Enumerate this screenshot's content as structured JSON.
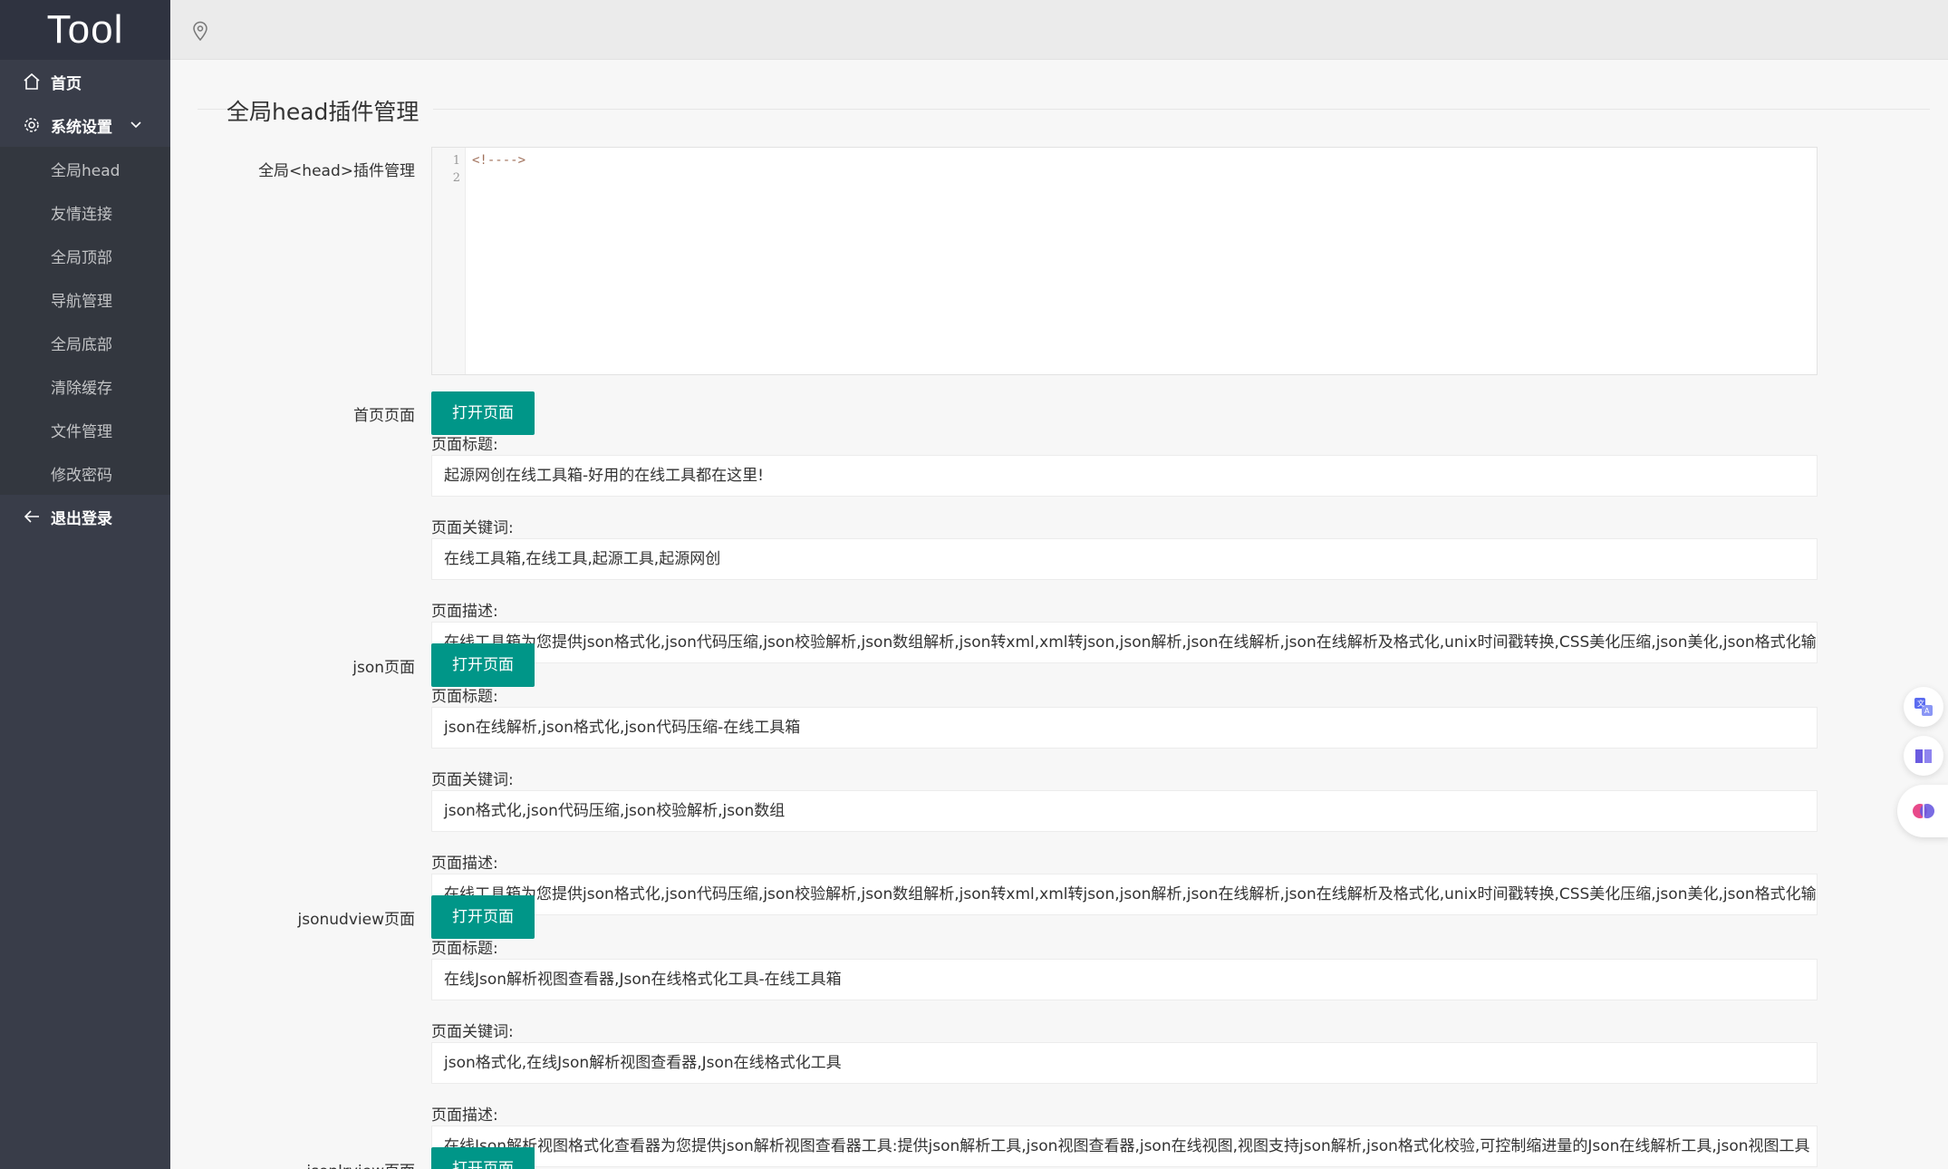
{
  "app": {
    "logo": "Tool"
  },
  "sidebar": {
    "home": "首页",
    "settings": "系统设置",
    "sub_items": [
      "全局head",
      "友情连接",
      "全局顶部",
      "导航管理",
      "全局底部",
      "清除缓存",
      "文件管理",
      "修改密码"
    ],
    "logout": "退出登录"
  },
  "main": {
    "title": "全局head插件管理",
    "editor": {
      "label": "全局<head>插件管理",
      "line_numbers": [
        "1",
        "2"
      ],
      "code": "<!---->"
    },
    "labels": {
      "open_page": "打开页面",
      "page_title": "页面标题:",
      "page_keywords": "页面关键词:",
      "page_desc": "页面描述:"
    },
    "pages": [
      {
        "name": "首页页面",
        "title": "起源网创在线工具箱-好用的在线工具都在这里!",
        "keywords": "在线工具箱,在线工具,起源工具,起源网创",
        "description": "在线工具箱为您提供json格式化,json代码压缩,json校验解析,json数组解析,json转xml,xml转json,json解析,json在线解析,json在线解析及格式化,unix时间戳转换,CSS美化压缩,json美化,json格式化输出"
      },
      {
        "name": "json页面",
        "title": "json在线解析,json格式化,json代码压缩-在线工具箱",
        "keywords": "json格式化,json代码压缩,json校验解析,json数组",
        "description": "在线工具箱为您提供json格式化,json代码压缩,json校验解析,json数组解析,json转xml,xml转json,json解析,json在线解析,json在线解析及格式化,unix时间戳转换,CSS美化压缩,json美化,json格式化输出"
      },
      {
        "name": "jsonudview页面",
        "title": "在线Json解析视图查看器,Json在线格式化工具-在线工具箱",
        "keywords": "json格式化,在线Json解析视图查看器,Json在线格式化工具",
        "description": "在线Json解析视图格式化查看器为您提供json解析视图查看器工具:提供json解析工具,json视图查看器,json在线视图,视图支持json解析,json格式化校验,可控制缩进量的Json在线解析工具,json视图工具"
      },
      {
        "name": "jsonlrview页面",
        "title": "",
        "keywords": "",
        "description": ""
      }
    ]
  },
  "colors": {
    "sidebar": "#393d49",
    "logo_bg": "#2f3340",
    "accent": "#009688"
  }
}
